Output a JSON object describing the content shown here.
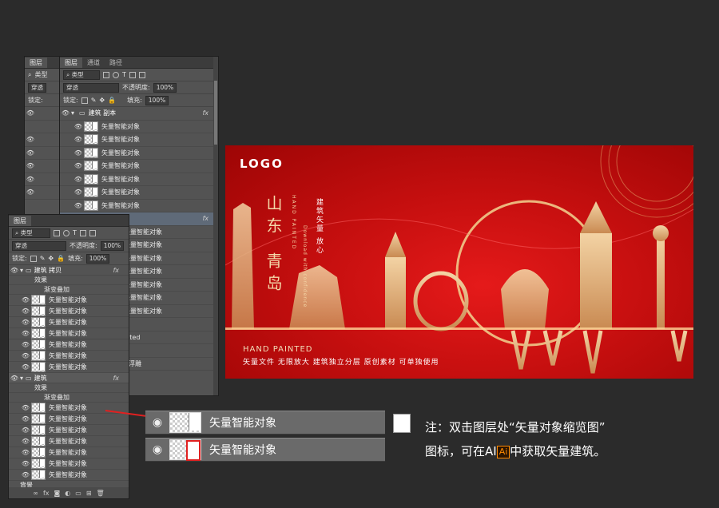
{
  "panel_back": {
    "tabs": [
      "图层"
    ],
    "kind": "类型",
    "blend": "穿透",
    "lock_label": "锁定:"
  },
  "panel_mid": {
    "tabs": [
      "图层",
      "通道",
      "路径"
    ],
    "kind": "类型",
    "blend": "穿透",
    "opacity_label": "不透明度:",
    "opacity": "100%",
    "lock_label": "锁定:",
    "fill_label": "填充:",
    "fill": "100%",
    "group_name": "建筑 副本",
    "layer_name": "矢量智能对象",
    "partial_text": "inted",
    "partial_text2": "D浮雕",
    "fx": "fx"
  },
  "panel_front": {
    "tabs": [
      "图层"
    ],
    "kind": "类型",
    "blend": "穿透",
    "opacity_label": "不透明度:",
    "opacity": "100%",
    "lock_label": "锁定:",
    "fill_label": "填充:",
    "fill": "100%",
    "group1": "建筑 拷贝",
    "group2": "建筑",
    "effects": "效果",
    "gradient_overlay": "渐变叠加",
    "layer_name": "矢量智能对象",
    "bottom_group": "背景",
    "fx": "fx"
  },
  "banner": {
    "logo": "LOGO",
    "title1": "山东",
    "title2": "青岛",
    "en_vertical": "HAND PAINTED",
    "en_vertical2": "Download with confidence",
    "cn_vertical": "建筑矢量 放心",
    "hand_painted": "HAND PAINTED",
    "subtitle": "矢量文件  无限放大  建筑独立分层  原创素材  可单独使用"
  },
  "callout": {
    "layer_name": "矢量智能对象",
    "note_line1": "注：双击图层处“矢量对象缩览图”",
    "note_line2_a": "图标，可在AI",
    "ai_icon": "Ai",
    "note_line2_b": "中获取矢量建筑。"
  },
  "colors": {
    "banner_red": "#d11010",
    "gold": "#e8c18a",
    "arrow": "#e02020"
  }
}
